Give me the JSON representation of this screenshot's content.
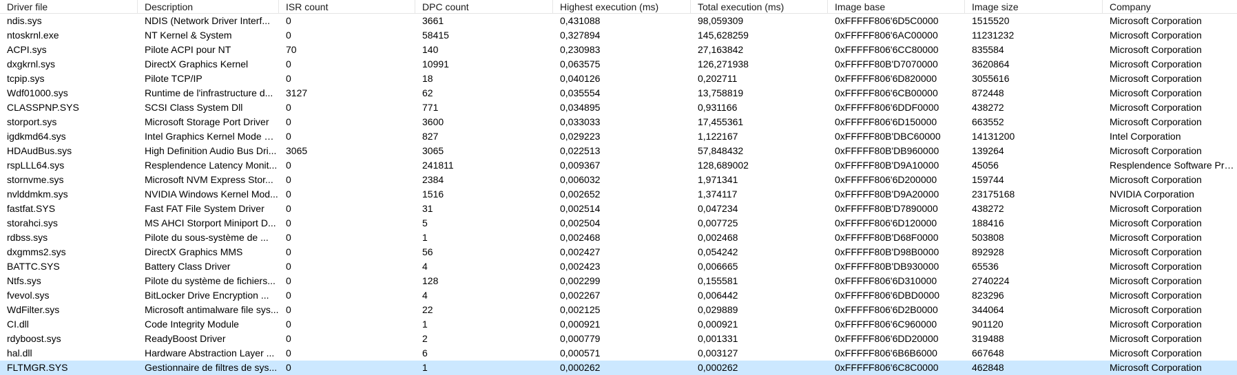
{
  "columns": [
    "Driver file",
    "Description",
    "ISR count",
    "DPC count",
    "Highest execution (ms)",
    "Total execution (ms)",
    "Image base",
    "Image size",
    "Company"
  ],
  "rows": [
    [
      "ndis.sys",
      "NDIS (Network Driver Interf...",
      "0",
      "3661",
      "0,431088",
      "98,059309",
      "0xFFFFF806'6D5C0000",
      "1515520",
      "Microsoft Corporation"
    ],
    [
      "ntoskrnl.exe",
      "NT Kernel & System",
      "0",
      "58415",
      "0,327894",
      "145,628259",
      "0xFFFFF806'6AC00000",
      "11231232",
      "Microsoft Corporation"
    ],
    [
      "ACPI.sys",
      "Pilote ACPI pour NT",
      "70",
      "140",
      "0,230983",
      "27,163842",
      "0xFFFFF806'6CC80000",
      "835584",
      "Microsoft Corporation"
    ],
    [
      "dxgkrnl.sys",
      "DirectX Graphics Kernel",
      "0",
      "10991",
      "0,063575",
      "126,271938",
      "0xFFFFF80B'D7070000",
      "3620864",
      "Microsoft Corporation"
    ],
    [
      "tcpip.sys",
      "Pilote TCP/IP",
      "0",
      "18",
      "0,040126",
      "0,202711",
      "0xFFFFF806'6D820000",
      "3055616",
      "Microsoft Corporation"
    ],
    [
      "Wdf01000.sys",
      "Runtime de l'infrastructure d...",
      "3127",
      "62",
      "0,035554",
      "13,758819",
      "0xFFFFF806'6CB00000",
      "872448",
      "Microsoft Corporation"
    ],
    [
      "CLASSPNP.SYS",
      "SCSI Class System Dll",
      "0",
      "771",
      "0,034895",
      "0,931166",
      "0xFFFFF806'6DDF0000",
      "438272",
      "Microsoft Corporation"
    ],
    [
      "storport.sys",
      "Microsoft Storage Port Driver",
      "0",
      "3600",
      "0,033033",
      "17,455361",
      "0xFFFFF806'6D150000",
      "663552",
      "Microsoft Corporation"
    ],
    [
      "igdkmd64.sys",
      "Intel Graphics Kernel Mode D...",
      "0",
      "827",
      "0,029223",
      "1,122167",
      "0xFFFFF80B'DBC60000",
      "14131200",
      "Intel Corporation"
    ],
    [
      "HDAudBus.sys",
      "High Definition Audio Bus Dri...",
      "3065",
      "3065",
      "0,022513",
      "57,848432",
      "0xFFFFF80B'DB960000",
      "139264",
      "Microsoft Corporation"
    ],
    [
      "rspLLL64.sys",
      "Resplendence Latency Monit...",
      "0",
      "241811",
      "0,009367",
      "128,689002",
      "0xFFFFF80B'D9A10000",
      "45056",
      "Resplendence Software Proj..."
    ],
    [
      "stornvme.sys",
      "Microsoft NVM Express Stor...",
      "0",
      "2384",
      "0,006032",
      "1,971341",
      "0xFFFFF806'6D200000",
      "159744",
      "Microsoft Corporation"
    ],
    [
      "nvlddmkm.sys",
      "NVIDIA Windows Kernel Mod...",
      "0",
      "1516",
      "0,002652",
      "1,374117",
      "0xFFFFF80B'D9A20000",
      "23175168",
      "NVIDIA Corporation"
    ],
    [
      "fastfat.SYS",
      "Fast FAT File System Driver",
      "0",
      "31",
      "0,002514",
      "0,047234",
      "0xFFFFF80B'D7890000",
      "438272",
      "Microsoft Corporation"
    ],
    [
      "storahci.sys",
      "MS AHCI Storport Miniport D...",
      "0",
      "5",
      "0,002504",
      "0,007725",
      "0xFFFFF806'6D120000",
      "188416",
      "Microsoft Corporation"
    ],
    [
      "rdbss.sys",
      "Pilote du sous-système de ...",
      "0",
      "1",
      "0,002468",
      "0,002468",
      "0xFFFFF80B'D68F0000",
      "503808",
      "Microsoft Corporation"
    ],
    [
      "dxgmms2.sys",
      "DirectX Graphics MMS",
      "0",
      "56",
      "0,002427",
      "0,054242",
      "0xFFFFF80B'D98B0000",
      "892928",
      "Microsoft Corporation"
    ],
    [
      "BATTC.SYS",
      "Battery Class Driver",
      "0",
      "4",
      "0,002423",
      "0,006665",
      "0xFFFFF80B'DB930000",
      "65536",
      "Microsoft Corporation"
    ],
    [
      "Ntfs.sys",
      "Pilote du système de fichiers...",
      "0",
      "128",
      "0,002299",
      "0,155581",
      "0xFFFFF806'6D310000",
      "2740224",
      "Microsoft Corporation"
    ],
    [
      "fvevol.sys",
      "BitLocker Drive Encryption ...",
      "0",
      "4",
      "0,002267",
      "0,006442",
      "0xFFFFF806'6DBD0000",
      "823296",
      "Microsoft Corporation"
    ],
    [
      "WdFilter.sys",
      "Microsoft antimalware file sys...",
      "0",
      "22",
      "0,002125",
      "0,029889",
      "0xFFFFF806'6D2B0000",
      "344064",
      "Microsoft Corporation"
    ],
    [
      "CI.dll",
      "Code Integrity Module",
      "0",
      "1",
      "0,000921",
      "0,000921",
      "0xFFFFF806'6C960000",
      "901120",
      "Microsoft Corporation"
    ],
    [
      "rdyboost.sys",
      "ReadyBoost Driver",
      "0",
      "2",
      "0,000779",
      "0,001331",
      "0xFFFFF806'6DD20000",
      "319488",
      "Microsoft Corporation"
    ],
    [
      "hal.dll",
      "Hardware Abstraction Layer ...",
      "0",
      "6",
      "0,000571",
      "0,003127",
      "0xFFFFF806'6B6B6000",
      "667648",
      "Microsoft Corporation"
    ],
    [
      "FLTMGR.SYS",
      "Gestionnaire de filtres de sys...",
      "0",
      "1",
      "0,000262",
      "0,000262",
      "0xFFFFF806'6C8C0000",
      "462848",
      "Microsoft Corporation"
    ]
  ],
  "selected_row_index": 24,
  "colors": {
    "selection": "#cce8ff",
    "header_divider": "#e5e5e5"
  }
}
